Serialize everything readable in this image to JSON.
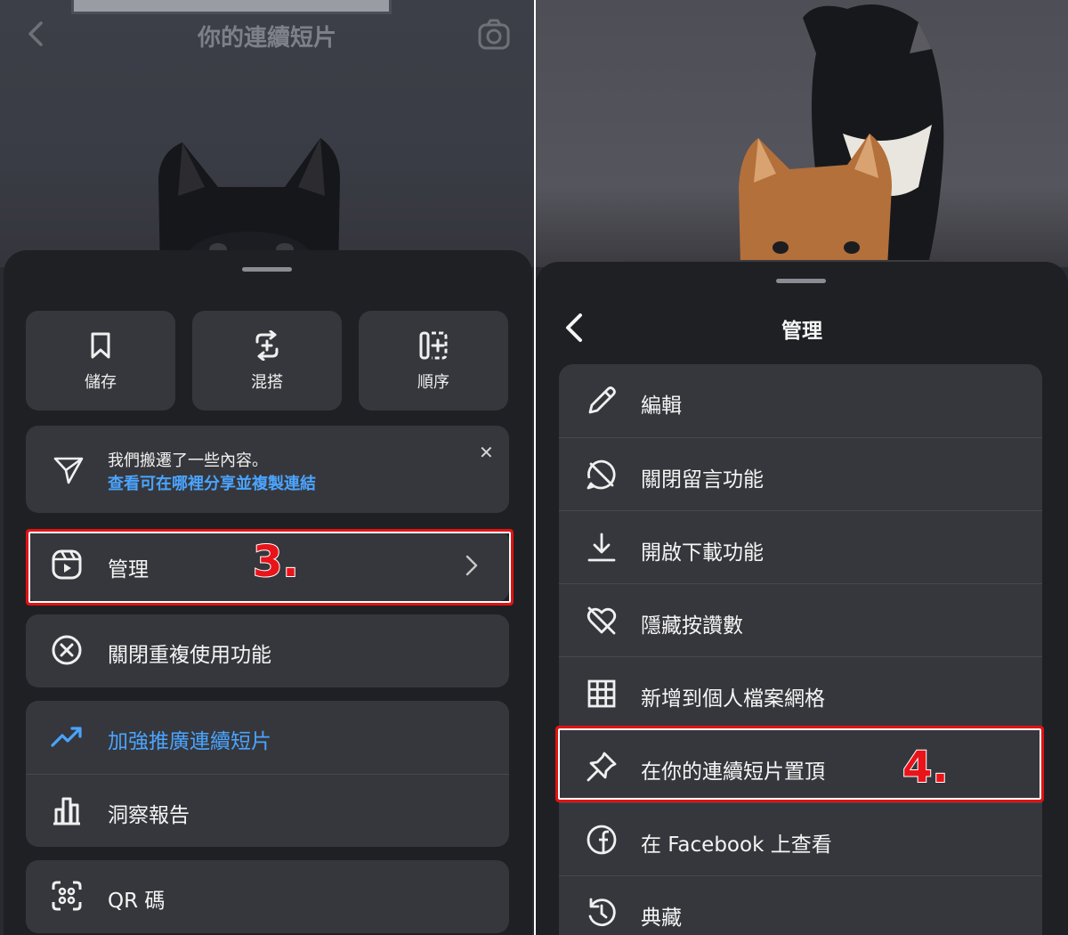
{
  "left": {
    "header": {
      "title": "你的連續短片"
    },
    "tiles": [
      {
        "label": "儲存",
        "icon": "bookmark-icon"
      },
      {
        "label": "混搭",
        "icon": "remix-icon"
      },
      {
        "label": "順序",
        "icon": "sequence-icon"
      }
    ],
    "notice": {
      "text": "我們搬遷了一些內容。",
      "link": "查看可在哪裡分享並複製連結",
      "close": "✕"
    },
    "menu": {
      "manage": "管理",
      "disable_reuse": "關閉重複使用功能",
      "boost": "加強推廣連續短片",
      "insights": "洞察報告",
      "qr": "QR 碼"
    },
    "step_marker": "3."
  },
  "right": {
    "sheet_title": "管理",
    "items": [
      {
        "label": "編輯",
        "icon": "pencil-icon"
      },
      {
        "label": "關閉留言功能",
        "icon": "comment-off-icon"
      },
      {
        "label": "開啟下載功能",
        "icon": "download-icon"
      },
      {
        "label": "隱藏按讚數",
        "icon": "heart-off-icon"
      },
      {
        "label": "新增到個人檔案網格",
        "icon": "grid-icon"
      },
      {
        "label": "在你的連續短片置頂",
        "icon": "pin-icon"
      },
      {
        "label": "在 Facebook 上查看",
        "icon": "facebook-icon"
      },
      {
        "label": "典藏",
        "icon": "archive-icon"
      }
    ],
    "step_marker": "4."
  },
  "colors": {
    "sheet": "#1f2024",
    "card": "#36373c",
    "link_blue": "#4aa4ff",
    "highlight_red": "#e11313"
  }
}
